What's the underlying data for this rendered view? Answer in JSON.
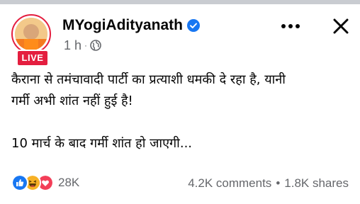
{
  "post": {
    "page_name": "MYogiAdityanath",
    "live_label": "LIVE",
    "time_ago": "1 h",
    "meta_separator": "·",
    "audience_icon": "globe-icon",
    "verified_icon": "verified-badge-icon",
    "text_line1": "कैराना से तमंचावादी पार्टी का प्रत्याशी धमकी दे रहा है, यानी",
    "text_line2": "गर्मी अभी शांत नहीं हुई है!",
    "text_line3": "10 मार्च के बाद गर्मी शांत हो जाएगी...",
    "reaction_count": "28K",
    "comments": "4.2K comments",
    "stats_separator": "•",
    "shares": "1.8K shares"
  },
  "colors": {
    "live_red": "#e41e3f",
    "verified_blue": "#1877f2",
    "meta_grey": "#65676b",
    "top_strip": "#c9ccd1"
  },
  "icons": {
    "more": "more-horizontal-icon",
    "close": "close-icon",
    "reactions": [
      "like-reaction-icon",
      "haha-reaction-icon",
      "love-reaction-icon"
    ]
  }
}
